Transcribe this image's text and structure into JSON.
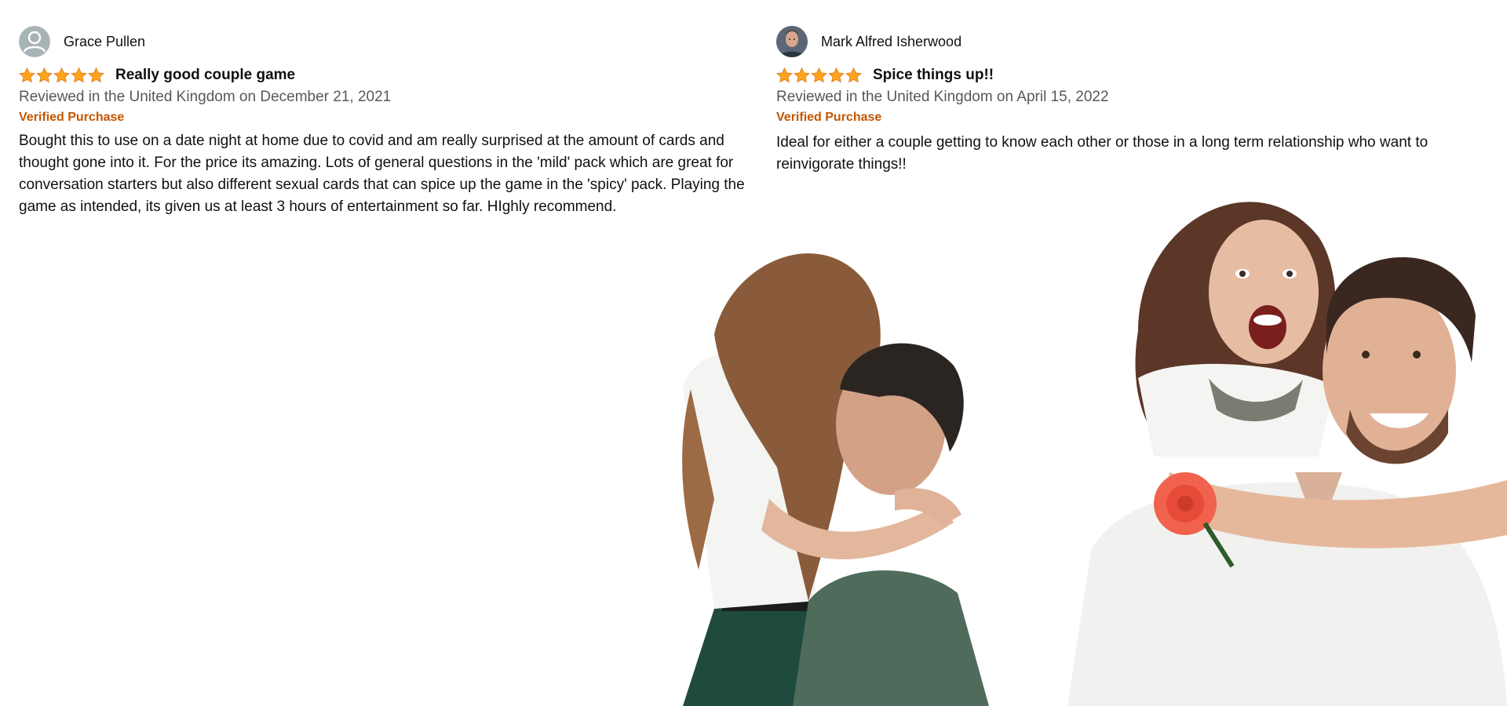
{
  "reviews": [
    {
      "reviewer_name": "Grace Pullen",
      "avatar_icon": "default-avatar-icon",
      "rating": 5,
      "rating_max": 5,
      "title": "Really good couple game",
      "date_line": "Reviewed in the United Kingdom on December 21, 2021",
      "verified_label": "Verified Purchase",
      "body": "Bought this to use on a date night at home due to covid and am really surprised at the amount of cards and thought gone into it. For the price its amazing. Lots of general questions in the 'mild' pack which are great for conversation starters but also different sexual cards that can spice up the game in the 'spicy' pack. Playing the game as intended, its given us at least 3 hours of entertainment so far. HIghly recommend."
    },
    {
      "reviewer_name": "Mark Alfred Isherwood",
      "avatar_icon": "profile-photo-avatar",
      "rating": 5,
      "rating_max": 5,
      "title": "Spice things up!!",
      "date_line": "Reviewed in the United Kingdom on April 15, 2022",
      "verified_label": "Verified Purchase",
      "body": "Ideal for either a couple getting to know each other or those in a long term relationship who want to reinvigorate things!!"
    }
  ],
  "photos": [
    {
      "icon": "couple-kissing-photo"
    },
    {
      "icon": "couple-piggyback-photo"
    }
  ],
  "colors": {
    "star": "#ffa41c",
    "star_stroke": "#de7921",
    "verified": "#c45500",
    "secondary_text": "#565959",
    "primary_text": "#0f1111"
  }
}
